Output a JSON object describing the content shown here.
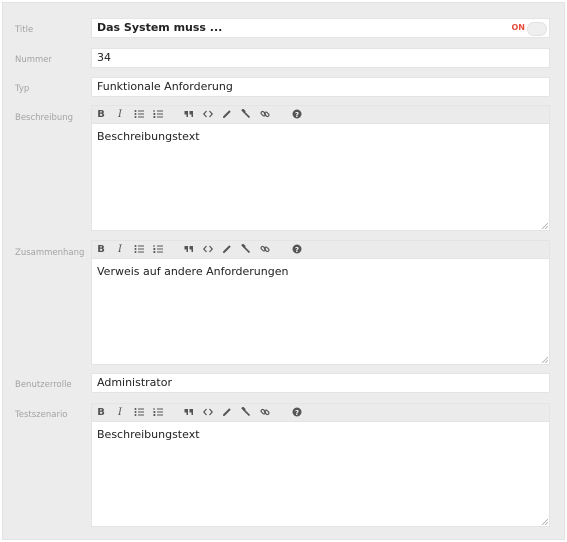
{
  "form": {
    "title": {
      "label": "Title",
      "value": "Das System muss ...",
      "toggle_label": "ON"
    },
    "nummer": {
      "label": "Nummer",
      "value": "34"
    },
    "typ": {
      "label": "Typ",
      "value": "Funktionale Anforderung"
    },
    "beschreibung": {
      "label": "Beschreibung",
      "content": "Beschreibungstext"
    },
    "zusammenhang": {
      "label": "Zusammenhang",
      "content": "Verweis auf andere Anforderungen"
    },
    "benutzerrolle": {
      "label": "Benutzerrolle",
      "value": "Administrator"
    },
    "testszenario": {
      "label": "Testszenario",
      "content": "Beschreibungstext"
    }
  },
  "toolbar": {
    "bold": "B",
    "italic": "I",
    "icons": [
      "bold-icon",
      "italic-icon",
      "bullet-list-icon",
      "numbered-list-icon",
      "quote-icon",
      "code-icon",
      "pencil-icon",
      "clear-format-icon",
      "link-icon",
      "help-icon"
    ]
  },
  "colors": {
    "toggle_on": "#e74c3c",
    "panel_bg": "#ececec"
  }
}
